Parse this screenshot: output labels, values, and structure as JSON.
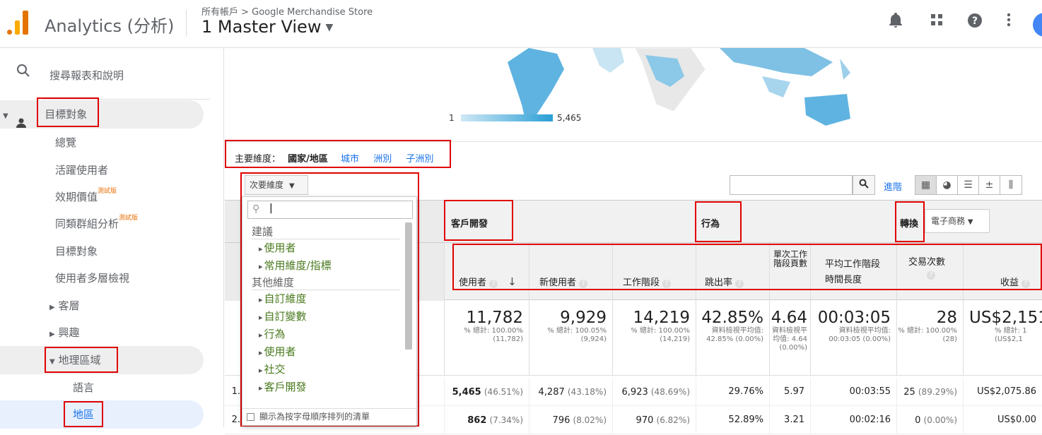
{
  "topbar": {
    "app_title": "Analytics (分析)",
    "breadcrumb": "所有帳戶 > Google Merchandise Store",
    "view": "1 Master View",
    "icons": [
      "bell-icon",
      "apps-icon",
      "help-icon",
      "more-icon"
    ]
  },
  "sidebar": {
    "search_text": "搜尋報表和說明",
    "items": [
      {
        "label": "目標對象"
      },
      {
        "label": "總覽"
      },
      {
        "label": "活躍使用者"
      },
      {
        "label": "效期價值",
        "badge": "測試版"
      },
      {
        "label": "同類群組分析",
        "badge": "測試版"
      },
      {
        "label": "目標對象"
      },
      {
        "label": "使用者多層檢視"
      },
      {
        "label": "客層"
      },
      {
        "label": "興趣"
      },
      {
        "label": "地理區域"
      },
      {
        "label": "語言"
      },
      {
        "label": "地區"
      }
    ]
  },
  "map": {
    "legend_min": "1",
    "legend_max": "5,465"
  },
  "dimensions": {
    "label": "主要維度：",
    "active": "國家/地區",
    "links": [
      "城市",
      "洲別",
      "子洲別"
    ]
  },
  "secondary": {
    "button": "次要維度",
    "groups": [
      {
        "header": "建議",
        "items": [
          "使用者",
          "常用維度/指標"
        ]
      },
      {
        "header": "其他維度",
        "items": [
          "自訂維度",
          "自訂變數",
          "行為",
          "使用者",
          "社交",
          "客戶開發"
        ]
      }
    ],
    "footer": "顯示為按字母順序排列的清單"
  },
  "toolbar": {
    "advanced": "進階"
  },
  "table": {
    "groups": {
      "acquisition": "客戶開發",
      "behavior": "行為",
      "conversion": "轉換",
      "ecommerce": "電子商務"
    },
    "columns": [
      "使用者",
      "新使用者",
      "工作階段",
      "跳出率",
      "單次工作階段頁數",
      "平均工作階段時間長度",
      "交易次數",
      "收益"
    ],
    "totals": [
      {
        "big": "11,782",
        "sub": "% 總計: 100.00% (11,782)"
      },
      {
        "big": "9,929",
        "sub": "% 總計: 100.05% (9,924)"
      },
      {
        "big": "14,219",
        "sub": "% 總計: 100.00% (14,219)"
      },
      {
        "big": "42.85%",
        "sub": "資料檢視平均值: 42.85% (0.00%)"
      },
      {
        "big": "4.64",
        "sub": "資料檢視平均值: 4.64 (0.00%)"
      },
      {
        "big": "00:03:05",
        "sub": "資料檢視平均值: 00:03:05 (0.00%)"
      },
      {
        "big": "28",
        "sub": "% 總計: 100.00% (28)"
      },
      {
        "big": "US$2,151",
        "sub": "% 總計: 1 (US$2,1"
      }
    ],
    "rows": [
      {
        "num": "1.",
        "users": "5,465",
        "users_pct": "(46.51%)",
        "new": "4,287",
        "new_pct": "(43.18%)",
        "sessions": "6,923",
        "sessions_pct": "(48.69%)",
        "bounce": "29.76%",
        "pages": "5.97",
        "duration": "00:03:55",
        "trans": "25",
        "trans_pct": "(89.29%)",
        "revenue": "US$2,075.86"
      },
      {
        "num": "2.",
        "users": "862",
        "users_pct": "(7.34%)",
        "new": "796",
        "new_pct": "(8.02%)",
        "sessions": "970",
        "sessions_pct": "(6.82%)",
        "bounce": "52.89%",
        "pages": "3.21",
        "duration": "00:02:16",
        "trans": "0",
        "trans_pct": "(0.00%)",
        "revenue": "US$0.00"
      }
    ]
  }
}
